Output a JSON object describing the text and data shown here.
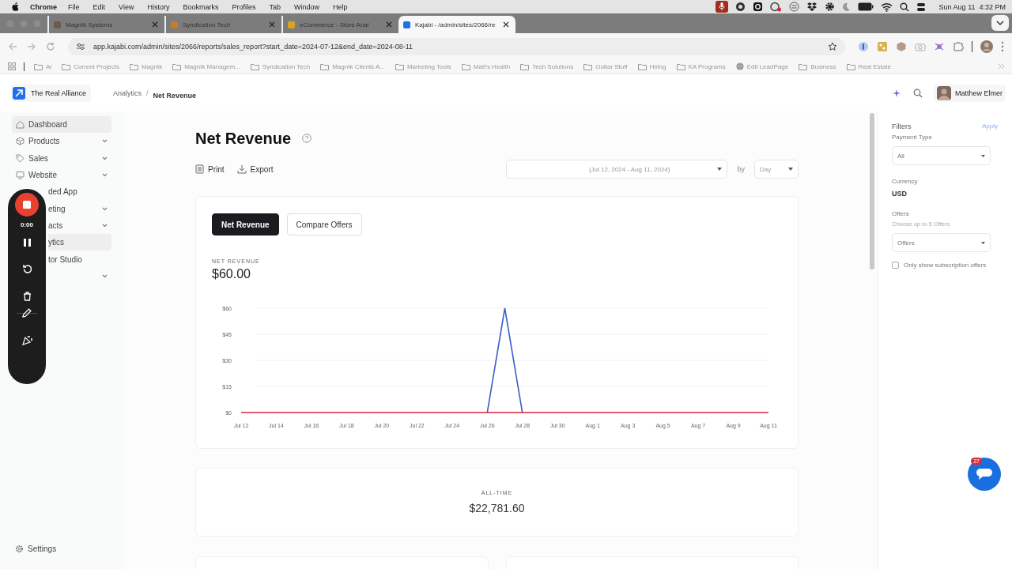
{
  "menubar": {
    "app": "Chrome",
    "menus": [
      "File",
      "Edit",
      "View",
      "History",
      "Bookmarks",
      "Profiles",
      "Tab",
      "Window",
      "Help"
    ],
    "clock": "Sun Aug 11  4:32 PM"
  },
  "browser": {
    "tabs": [
      {
        "title": "Magntk Systems",
        "selected": false
      },
      {
        "title": "Syndication Tech",
        "selected": false
      },
      {
        "title": "eCommerce - Store Anal",
        "selected": false
      },
      {
        "title": "Kajabi - /admin/sites/2066/re",
        "selected": true
      }
    ],
    "url": "app.kajabi.com/admin/sites/2066/reports/sales_report?start_date=2024-07-12&end_date=2024-08-11",
    "bookmarks": [
      {
        "label": "Ai",
        "kind": "folder"
      },
      {
        "label": "Current Projects",
        "kind": "folder"
      },
      {
        "label": "Magntk",
        "kind": "folder"
      },
      {
        "label": "Magntk Managem...",
        "kind": "folder"
      },
      {
        "label": "Syndication Tech",
        "kind": "folder"
      },
      {
        "label": "Magntk Clients A...",
        "kind": "folder"
      },
      {
        "label": "Marketing Tools",
        "kind": "folder"
      },
      {
        "label": "Matt's Health",
        "kind": "folder"
      },
      {
        "label": "Tech Solutions",
        "kind": "folder"
      },
      {
        "label": "Guitar Stuff",
        "kind": "folder"
      },
      {
        "label": "Hiring",
        "kind": "folder"
      },
      {
        "label": "KA Programs",
        "kind": "folder"
      },
      {
        "label": "Edit LeadPage",
        "kind": "page"
      },
      {
        "label": "Business",
        "kind": "folder"
      },
      {
        "label": "Real Estate",
        "kind": "folder"
      }
    ]
  },
  "header": {
    "site": "The Real Alliance",
    "breadcrumb": [
      "Analytics",
      "Net Revenue"
    ],
    "breadcrumb_separator": "/",
    "user": "Matthew Elmer"
  },
  "sidebar": {
    "items": [
      {
        "label": "Dashboard",
        "expandable": false,
        "highlighted": true,
        "covered": false
      },
      {
        "label": "Products",
        "expandable": true,
        "highlighted": false,
        "covered": false
      },
      {
        "label": "Sales",
        "expandable": true,
        "highlighted": false,
        "covered": false
      },
      {
        "label": "Website",
        "expandable": true,
        "highlighted": false,
        "covered": false
      },
      {
        "label": "ded App",
        "expandable": false,
        "highlighted": false,
        "covered": true
      },
      {
        "label": "eting",
        "expandable": true,
        "highlighted": false,
        "covered": true
      },
      {
        "label": "acts",
        "expandable": true,
        "highlighted": false,
        "covered": true
      },
      {
        "label": "ytics",
        "expandable": false,
        "highlighted": true,
        "covered": true
      },
      {
        "label": "tor Studio",
        "expandable": false,
        "highlighted": false,
        "covered": true
      },
      {
        "expandable": true,
        "highlighted": false,
        "covered": true
      }
    ],
    "footer": "Settings"
  },
  "recorder": {
    "timer": "0:00"
  },
  "report": {
    "title": "Net Revenue",
    "actions": [
      "Print",
      "Export"
    ],
    "date_range": "(Jul 12, 2024 - Aug 11, 2024)",
    "by_label": "by",
    "interval": "Day",
    "tabs": [
      {
        "label": "Net Revenue",
        "selected": true
      },
      {
        "label": "Compare Offers",
        "selected": false
      }
    ],
    "metric_label": "NET REVENUE",
    "metric_value": "$60.00",
    "chart_data": {
      "type": "line",
      "categories": [
        "Jul 12",
        null,
        "Jul 14",
        null,
        "Jul 16",
        null,
        "Jul 18",
        null,
        "Jul 20",
        null,
        "Jul 22",
        null,
        "Jul 24",
        null,
        "Jul 26",
        null,
        "Jul 28",
        null,
        "Jul 30",
        null,
        "Aug 1",
        null,
        "Aug 3",
        null,
        "Aug 5",
        null,
        "Aug 7",
        null,
        "Aug 9",
        null,
        "Aug 11"
      ],
      "ylim": [
        0,
        60
      ],
      "grid": true,
      "yticks": [
        {
          "value": 0,
          "label": "$0"
        },
        {
          "value": 15,
          "label": "$15"
        },
        {
          "value": 30,
          "label": "$30"
        },
        {
          "value": 45,
          "label": "$45"
        },
        {
          "value": 60,
          "label": "$60"
        }
      ],
      "series": [
        {
          "color": "#3b5fc9",
          "values": [
            null,
            null,
            null,
            null,
            null,
            null,
            null,
            null,
            null,
            null,
            null,
            null,
            null,
            null,
            0,
            60,
            0,
            null,
            null,
            null,
            null,
            null,
            null,
            null,
            null,
            null,
            null,
            null,
            null,
            null,
            null
          ]
        },
        {
          "color": "#e0243c",
          "values": [
            0,
            0,
            0,
            0,
            0,
            0,
            0,
            0,
            0,
            0,
            0,
            0,
            0,
            0,
            0,
            0,
            0,
            0,
            0,
            0,
            0,
            0,
            0,
            0,
            0,
            0,
            0,
            0,
            0,
            0,
            0
          ]
        }
      ]
    },
    "all_time": {
      "label": "ALL-TIME",
      "value": "$22,781.60"
    }
  },
  "filters": {
    "title": "Filters",
    "apply": "Apply",
    "payment_type": {
      "label": "Payment Type",
      "value": "All"
    },
    "currency": {
      "label": "Currency",
      "value": "USD"
    },
    "offers": {
      "label": "Offers",
      "hint": "Choose up to 5 Offers",
      "value": "Offers"
    },
    "subscription_only": {
      "label": "Only show subscription offers",
      "checked": false
    }
  },
  "chat": {
    "badge": "27"
  }
}
